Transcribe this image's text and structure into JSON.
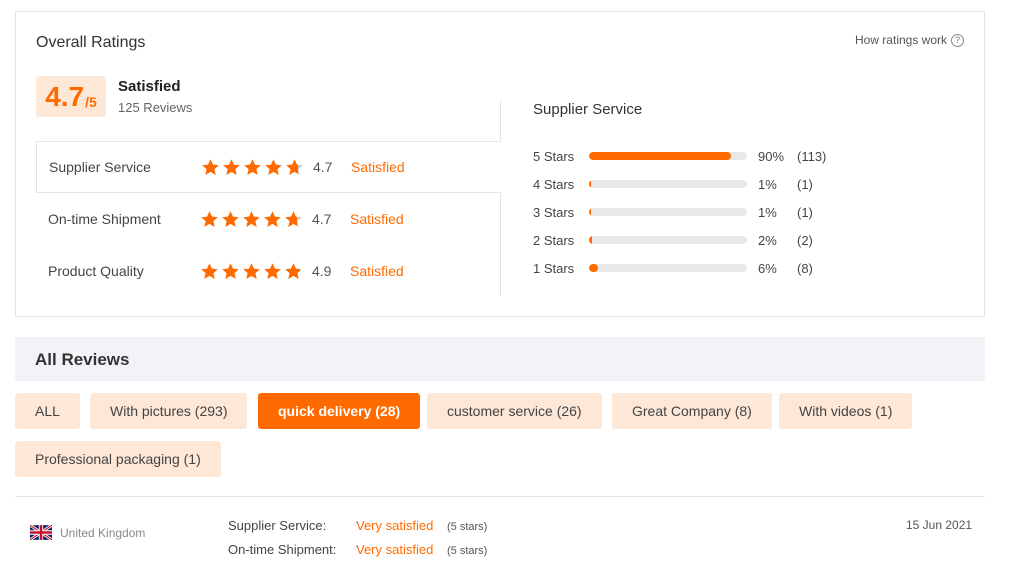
{
  "overall": {
    "title": "Overall Ratings",
    "how_link": "How ratings work",
    "score": "4.7",
    "score_denominator": "/5",
    "score_label": "Satisfied",
    "reviews_count": "125 Reviews"
  },
  "categories": [
    {
      "name": "Supplier Service",
      "score": "4.7",
      "status": "Satisfied",
      "stars": 4.7
    },
    {
      "name": "On-time Shipment",
      "score": "4.7",
      "status": "Satisfied",
      "stars": 4.7
    },
    {
      "name": "Product Quality",
      "score": "4.9",
      "status": "Satisfied",
      "stars": 4.9
    }
  ],
  "distribution": {
    "title": "Supplier Service",
    "rows": [
      {
        "label": "5 Stars",
        "percent": "90%",
        "count": "(113)",
        "fraction": 0.9
      },
      {
        "label": "4 Stars",
        "percent": "1%",
        "count": "(1)",
        "fraction": 0.01
      },
      {
        "label": "3 Stars",
        "percent": "1%",
        "count": "(1)",
        "fraction": 0.01
      },
      {
        "label": "2 Stars",
        "percent": "2%",
        "count": "(2)",
        "fraction": 0.02
      },
      {
        "label": "1 Stars",
        "percent": "6%",
        "count": "(8)",
        "fraction": 0.06
      }
    ]
  },
  "all_reviews": {
    "title": "All Reviews",
    "tags": [
      {
        "label": "ALL",
        "active": false
      },
      {
        "label": "With pictures (293)",
        "active": false
      },
      {
        "label": "quick delivery (28)",
        "active": true
      },
      {
        "label": "customer service (26)",
        "active": false
      },
      {
        "label": "Great Company (8)",
        "active": false
      },
      {
        "label": "With videos (1)",
        "active": false
      },
      {
        "label": "Professional packaging (1)",
        "active": false
      }
    ]
  },
  "review": {
    "country": "United Kingdom",
    "date": "15 Jun 2021",
    "lines": [
      {
        "label": "Supplier Service:",
        "value": "Very satisfied",
        "stars": "(5 stars)"
      },
      {
        "label": "On-time Shipment:",
        "value": "Very satisfied",
        "stars": "(5 stars)"
      }
    ]
  },
  "colors": {
    "accent": "#ff6a00",
    "accent_light": "#fde7d6",
    "star_empty": "#cccccc"
  },
  "icons": {
    "help": "question-circle-icon",
    "star": "star-icon",
    "flag": "uk-flag-icon"
  }
}
